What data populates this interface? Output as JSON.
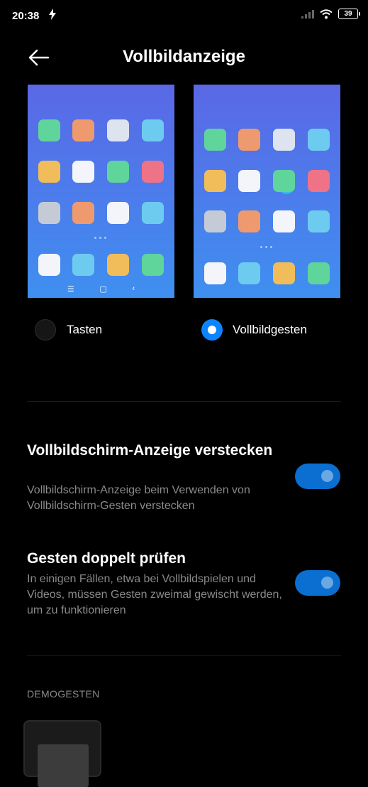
{
  "status": {
    "time": "20:38",
    "battery": "39"
  },
  "header": {
    "title": "Vollbildanzeige"
  },
  "options": [
    {
      "label": "Tasten",
      "selected": false
    },
    {
      "label": "Vollbildgesten",
      "selected": true
    }
  ],
  "previews": {
    "tile_colors": [
      "#5fd49b",
      "#ef9a6e",
      "#dde3ef",
      "#6ecbf0",
      "#f1bd5b",
      "#f3f5fa",
      "#5fd49b",
      "#ee7387",
      "#c5cbd6",
      "#ef9a6e",
      "#f3f5fa",
      "#6ecbf0",
      "#f3f5fa",
      "#6ecbf0",
      "#f1bd5b",
      "#5fd49b"
    ]
  },
  "settings": [
    {
      "title": "Vollbildschirm-Anzeige verstecken",
      "description": "Vollbildschirm-Anzeige beim Verwenden von Vollbildschirm-Gesten verstecken",
      "enabled": true
    },
    {
      "title": "Gesten doppelt prüfen",
      "description": "In einigen Fällen, etwa bei Vollbildspielen und Videos, müssen Gesten zweimal gewischt werden, um zu funktionieren",
      "enabled": true
    }
  ],
  "section": {
    "label": "DEMOGESTEN"
  },
  "colors": {
    "accent": "#0d84ff",
    "toggle_on": "#0a6fd0",
    "background": "#000000",
    "secondary_text": "#8a8a8a"
  }
}
